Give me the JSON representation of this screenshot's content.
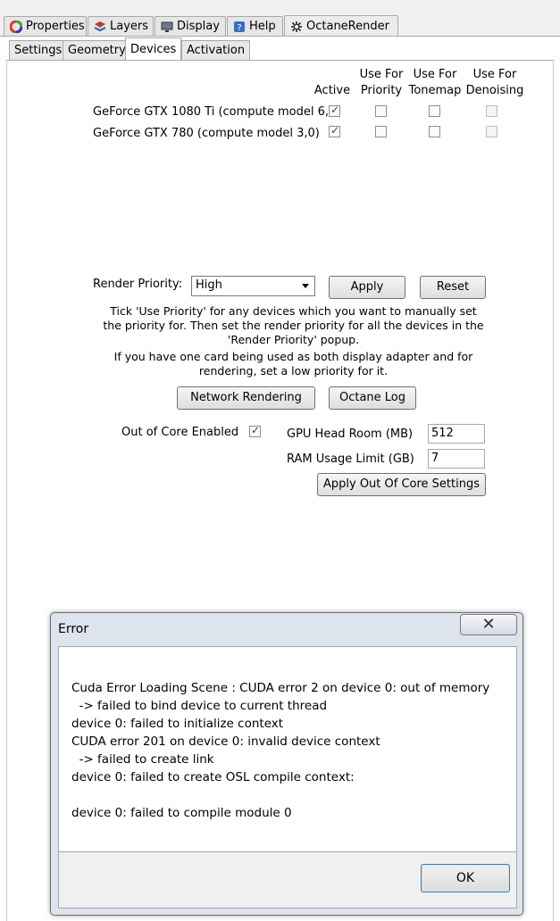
{
  "top_tabs": [
    {
      "label": "Properties",
      "icon": "color-wheel-icon"
    },
    {
      "label": "Layers",
      "icon": "layers-icon"
    },
    {
      "label": "Display",
      "icon": "monitor-icon"
    },
    {
      "label": "Help",
      "icon": "help-icon"
    },
    {
      "label": "OctaneRender",
      "icon": "octane-icon"
    }
  ],
  "sub_tabs": [
    "Settings",
    "Geometry",
    "Devices",
    "Activation"
  ],
  "active_sub_tab": "Devices",
  "devices_table": {
    "headers": {
      "active": "Active",
      "priority": [
        "Use For",
        "Priority"
      ],
      "tonemap": [
        "Use For",
        "Tonemap"
      ],
      "denoising": [
        "Use For",
        "Denoising"
      ]
    },
    "rows": [
      {
        "name": "GeForce GTX 1080 Ti (compute model 6,0)",
        "active": true,
        "priority": false,
        "tonemap": false,
        "denoising": false
      },
      {
        "name": "GeForce GTX 780 (compute model 3,0)",
        "active": true,
        "priority": false,
        "tonemap": false,
        "denoising": false
      }
    ]
  },
  "render_priority": {
    "label": "Render Priority:",
    "selected": "High",
    "apply_label": "Apply",
    "reset_label": "Reset"
  },
  "help_text": {
    "line1": "Tick 'Use Priority' for any devices which you want to manually set",
    "line2": "the priority for.  Then set the render priority for all the devices in the",
    "line3": "'Render Priority' popup.",
    "line4": "If you have one card being used as both display adapter and for",
    "line5": "rendering, set a low priority for it."
  },
  "buttons": {
    "network_rendering": "Network Rendering",
    "octane_log": "Octane Log",
    "apply_out_of_core": "Apply Out Of Core Settings"
  },
  "out_of_core": {
    "enabled_label": "Out of Core Enabled",
    "enabled": true,
    "gpu_headroom_label": "GPU Head Room (MB)",
    "gpu_headroom_value": "512",
    "ram_limit_label": "RAM Usage Limit (GB)",
    "ram_limit_value": "7"
  },
  "error_dialog": {
    "title": "Error",
    "close_glyph": "✕",
    "lines": [
      "Cuda Error Loading Scene : CUDA error 2 on device 0: out of memory",
      "  -> failed to bind device to current thread",
      "device 0: failed to initialize context",
      "CUDA error 201 on device 0: invalid device context",
      "  -> failed to create link",
      "device 0: failed to create OSL compile context:",
      "",
      "device 0: failed to compile module 0"
    ],
    "ok_label": "OK"
  }
}
